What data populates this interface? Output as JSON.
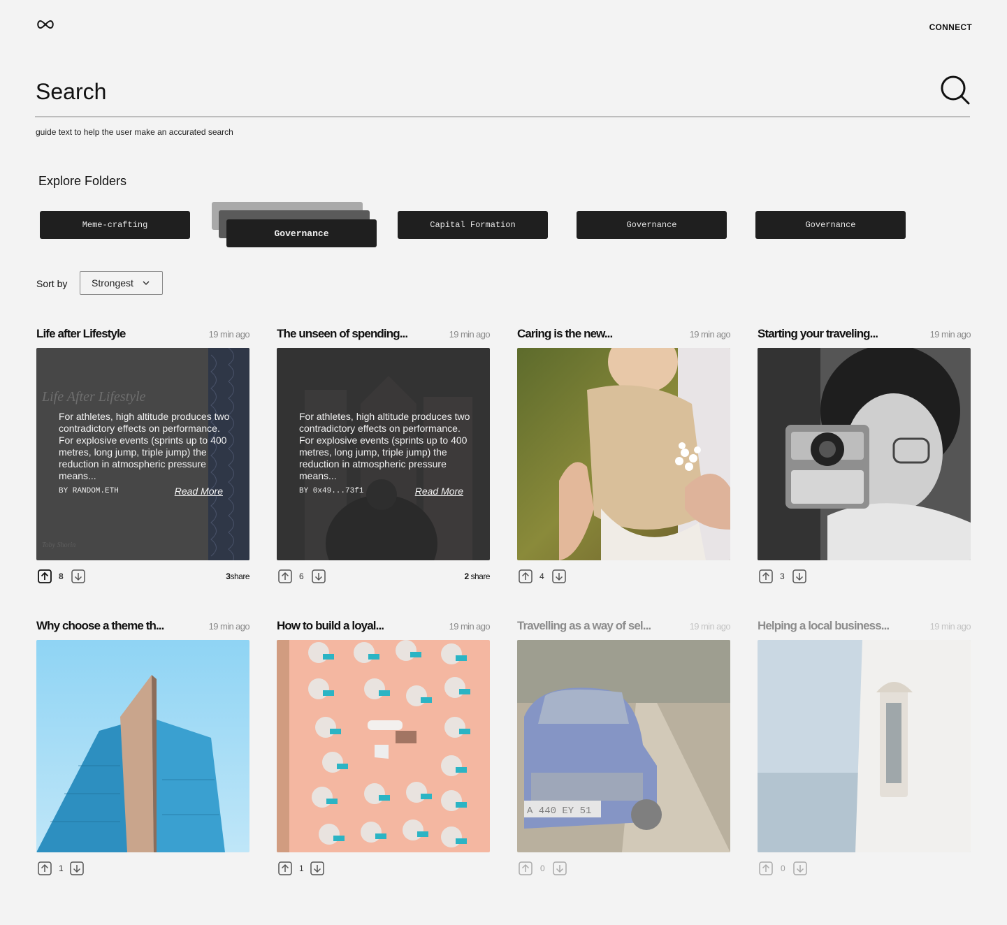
{
  "header": {
    "connect_label": "CONNECT"
  },
  "search": {
    "placeholder": "Search",
    "guide_text": "guide text to help the user make an accurated search"
  },
  "folders": {
    "title": "Explore Folders",
    "items": [
      {
        "label": "Meme-crafting"
      },
      {
        "label": "Governance"
      },
      {
        "label": "Capital Formation"
      },
      {
        "label": "Governance"
      },
      {
        "label": "Governance"
      }
    ]
  },
  "sort": {
    "label": "Sort by",
    "selected": "Strongest"
  },
  "cards": [
    {
      "title": "Life after Lifestyle",
      "time": "19 min ago",
      "votes": "8",
      "share_count": "3",
      "share_label": "share",
      "overlay_text": "For athletes, high altitude produces two contradictory effects on performance. For explosive events (sprints up to 400 metres, long jump, triple jump) the reduction in atmospheric pressure means...",
      "by": "BY RANDOM.ETH",
      "read_more": "Read More",
      "book_title": "Life After Lifestyle",
      "book_author": "Toby Shorin"
    },
    {
      "title": "The unseen of spending...",
      "time": "19 min ago",
      "votes": "6",
      "share_count": "2",
      "share_label": "share",
      "overlay_text": "For athletes, high altitude produces two contradictory effects on performance. For explosive events (sprints up to 400 metres, long jump, triple jump) the reduction in atmospheric pressure means...",
      "by": "BY 0x49...73f1",
      "read_more": "Read More"
    },
    {
      "title": "Caring is the new...",
      "time": "19 min ago",
      "votes": "4"
    },
    {
      "title": "Starting your traveling...",
      "time": "19 min ago",
      "votes": "3"
    },
    {
      "title": "Why choose a theme th...",
      "time": "19 min ago",
      "votes": "1"
    },
    {
      "title": "How to build a loyal...",
      "time": "19 min ago",
      "votes": "1"
    },
    {
      "title": "Travelling as a way of sel...",
      "time": "19 min ago",
      "votes": "0",
      "plate": "A 440 EY 51"
    },
    {
      "title": "Helping a local business...",
      "time": "19 min ago",
      "votes": "0"
    }
  ],
  "colors": {
    "background": "#f3f3f3",
    "folder_bg": "#1f1f1f",
    "text": "#111111",
    "muted": "#8a8a8a"
  }
}
